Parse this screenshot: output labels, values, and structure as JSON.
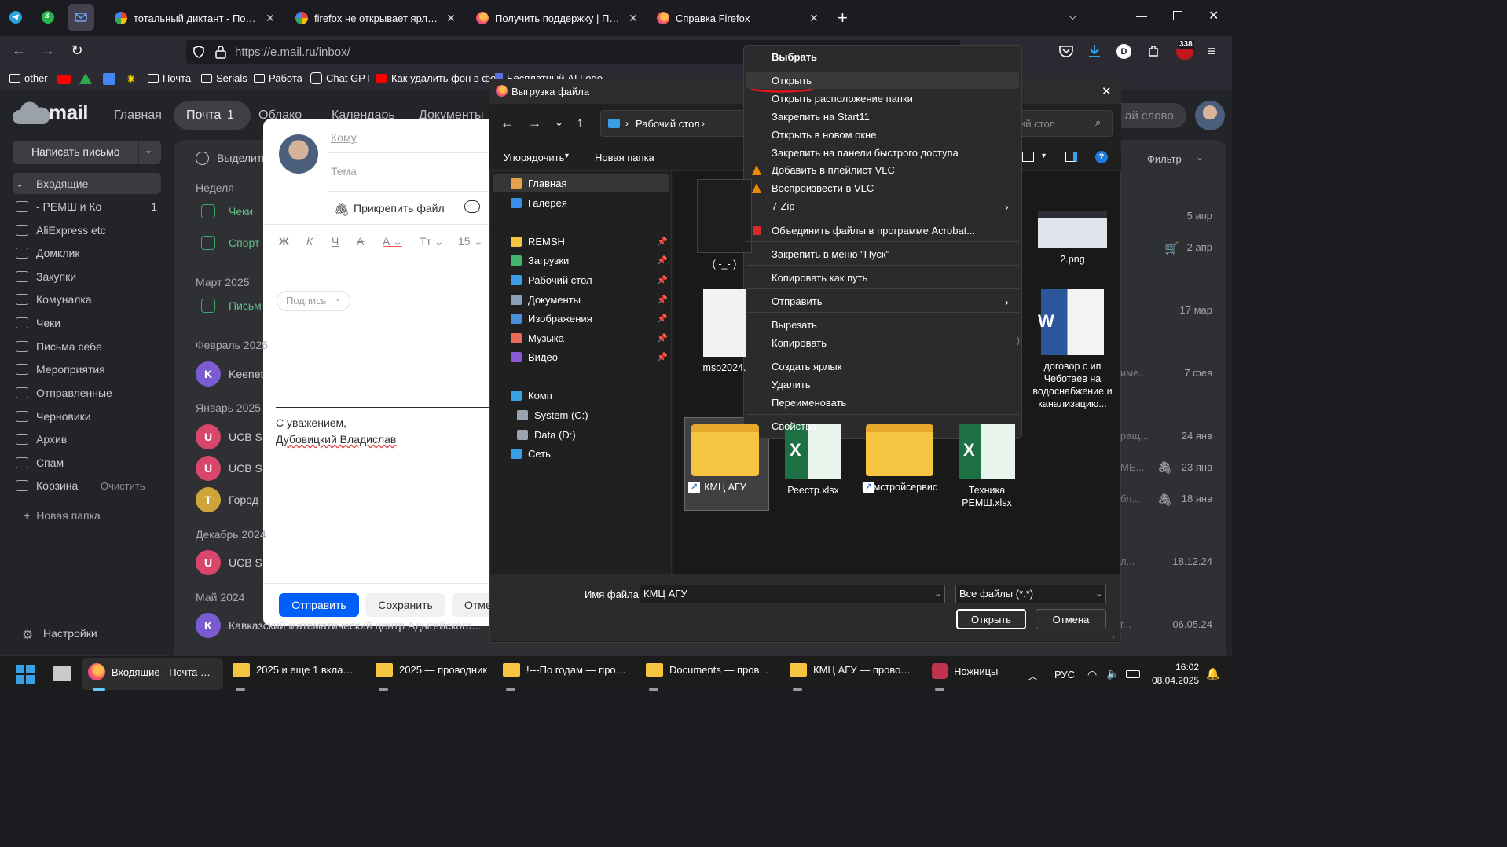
{
  "browser": {
    "tabs": [
      {
        "label": "тотальный диктант - Поиск в G",
        "favicon": "google-icon"
      },
      {
        "label": "firefox не открывает ярлык па",
        "favicon": "google-icon"
      },
      {
        "label": "Получить поддержку | Поддерж",
        "favicon": "firefox-icon"
      },
      {
        "label": "Справка Firefox",
        "favicon": "firefox-icon"
      }
    ],
    "pinned_badge": "3",
    "url": "https://e.mail.ru/inbox/",
    "bookmarks": [
      "other",
      "Почта",
      "Serials",
      "Работа",
      "Chat GPT",
      "Как удалить фон в фо...",
      "Бесплатный AI Logo"
    ],
    "notif_count": "338",
    "profile_letter": "D"
  },
  "mail": {
    "logo": "mail",
    "nav": {
      "home": "Главная",
      "mail": "Почта",
      "mail_count": "1",
      "cloud": "Облако",
      "calendar": "Календарь",
      "docs": "Документы"
    },
    "search_placeholder": "ай слово",
    "compose_button": "Написать письмо",
    "folders": [
      {
        "label": "Входящие",
        "count": ""
      },
      {
        "label": "- РЕМШ и Ко",
        "count": "1"
      },
      {
        "label": "AliExpress etc",
        "count": ""
      },
      {
        "label": "Домклик",
        "count": ""
      },
      {
        "label": "Закупки",
        "count": ""
      },
      {
        "label": "Комуналка",
        "count": ""
      },
      {
        "label": "Чеки",
        "count": ""
      },
      {
        "label": "Письма себе",
        "count": ""
      },
      {
        "label": "Мероприятия",
        "count": ""
      },
      {
        "label": "Отправленные",
        "count": ""
      },
      {
        "label": "Черновики",
        "count": ""
      },
      {
        "label": "Архив",
        "count": ""
      },
      {
        "label": "Спам",
        "count": ""
      },
      {
        "label": "Корзина",
        "count": ""
      }
    ],
    "clear_label": "Очистить",
    "new_folder": "Новая папка",
    "settings": "Настройки",
    "select_label": "Выделить",
    "filter_label": "Фильтр",
    "groups": [
      "Неделя",
      "Март 2025",
      "Февраль 2025",
      "Январь 2025",
      "Декабрь 2024",
      "Май 2024"
    ],
    "rows": [
      {
        "sender": "Чеки",
        "date": "5 апр",
        "avatar": ""
      },
      {
        "sender": "Спорт",
        "date": "2 апр",
        "avatar": ""
      },
      {
        "sender": "Письм",
        "date": "17 мар",
        "avatar": ""
      },
      {
        "sender": "Keenet",
        "date": "7 фев",
        "avatar": "K",
        "snippet": "име..."
      },
      {
        "sender": "UCB S",
        "date": "24 янв",
        "avatar": "U",
        "snippet": "ращ..."
      },
      {
        "sender": "UCB S",
        "date": "23 янв",
        "avatar": "U",
        "snippet": "МЕ..."
      },
      {
        "sender": "Город",
        "date": "18 янв",
        "avatar": "T",
        "snippet": "бл..."
      },
      {
        "sender": "UCB S",
        "date": "18.12.24",
        "avatar": "U",
        "snippet": "л..."
      },
      {
        "sender": "Кавказский математический центр Адыгейского...",
        "date": "06.05.24",
        "avatar": "K",
        "snippet": "г..."
      }
    ]
  },
  "compose": {
    "to_placeholder": "Кому",
    "subject_placeholder": "Тема",
    "attach": "Прикрепить файл",
    "font_size": "15",
    "signature_chip": "Подпись",
    "signature_line1": "С уважением,",
    "signature_line2": "Дубовицкий Владислав",
    "send": "Отправить",
    "save": "Сохранить",
    "cancel": "Отме"
  },
  "dialog": {
    "title": "Выгрузка файла",
    "path": "Рабочий стол",
    "search_placeholder": "ий стол",
    "organize": "Упорядочить",
    "new_folder": "Новая папка",
    "nav_items": [
      {
        "label": "Главная",
        "pinned": false,
        "color": "#e8a24a"
      },
      {
        "label": "Галерея",
        "pinned": false,
        "color": "#3a8ee6"
      },
      {
        "label": "REMSH",
        "pinned": true,
        "color": "#f5c542"
      },
      {
        "label": "Загрузки",
        "pinned": true,
        "color": "#41b56f"
      },
      {
        "label": "Рабочий стол",
        "pinned": true,
        "color": "#3aa0e6"
      },
      {
        "label": "Документы",
        "pinned": true,
        "color": "#8a9fb8"
      },
      {
        "label": "Изображения",
        "pinned": true,
        "color": "#4a90d9"
      },
      {
        "label": "Музыка",
        "pinned": true,
        "color": "#e96b5a"
      },
      {
        "label": "Видео",
        "pinned": true,
        "color": "#8b5bd6"
      },
      {
        "label": "Комп",
        "pinned": false,
        "color": "#3aa0e6"
      },
      {
        "label": "System (C:)",
        "pinned": false,
        "color": "#9aa4b0"
      },
      {
        "label": "Data (D:)",
        "pinned": false,
        "color": "#9aa4b0"
      },
      {
        "label": "Сеть",
        "pinned": false,
        "color": "#3aa0e6"
      }
    ],
    "files": [
      {
        "name": "( -_- )",
        "type": "shortcut-app"
      },
      {
        "name": "2.png",
        "type": "image"
      },
      {
        "name": "mso2024.",
        "type": "document"
      },
      {
        "name": "договор с ип Чеботаев на водоснабжение и канализацию...",
        "type": "word"
      },
      {
        "name": "КМЦ АГУ",
        "type": "folder-shortcut"
      },
      {
        "name": "Реестр.xlsx",
        "type": "excel"
      },
      {
        "name": "Ремстройсервис",
        "type": "folder-shortcut"
      },
      {
        "name": "Техника РЕМШ.xlsx",
        "type": "excel"
      }
    ],
    "filter_button": "Фильтр",
    "filename_label": "Имя файла:",
    "filename_value": "КМЦ АГУ",
    "filetype_value": "Все файлы (*.*)",
    "open_button": "Открыть",
    "cancel_button": "Отмена"
  },
  "context_menu": {
    "header": "Выбрать",
    "items": [
      {
        "label": "Открыть",
        "icon": "",
        "submenu": false
      },
      {
        "label": "Открыть расположение папки",
        "icon": "",
        "submenu": false
      },
      {
        "label": "Закрепить на Start11",
        "icon": "",
        "submenu": false
      },
      {
        "label": "Открыть в новом окне",
        "icon": "",
        "submenu": false
      },
      {
        "label": "Закрепить на панели быстрого доступа",
        "icon": "",
        "submenu": false
      },
      {
        "label": "Добавить в плейлист VLC",
        "icon": "vlc-icon",
        "submenu": false
      },
      {
        "label": "Воспроизвести в VLC",
        "icon": "vlc-icon",
        "submenu": false
      },
      {
        "label": "7-Zip",
        "icon": "",
        "submenu": true
      },
      {
        "label": "Объединить файлы в программе Acrobat...",
        "icon": "acrobat-icon",
        "submenu": false
      },
      {
        "label": "Закрепить в меню \"Пуск\"",
        "icon": "",
        "submenu": false
      },
      {
        "label": "Копировать как путь",
        "icon": "",
        "submenu": false
      },
      {
        "label": "Отправить",
        "icon": "",
        "submenu": true
      },
      {
        "label": "Вырезать",
        "icon": "",
        "submenu": false
      },
      {
        "label": "Копировать",
        "icon": "",
        "submenu": false
      },
      {
        "label": "Создать ярлык",
        "icon": "",
        "submenu": false
      },
      {
        "label": "Удалить",
        "icon": "",
        "submenu": false
      },
      {
        "label": "Переименовать",
        "icon": "",
        "submenu": false
      },
      {
        "label": "Свойства",
        "icon": "",
        "submenu": false
      }
    ],
    "highlight_color": "#e0161d"
  },
  "taskbar": {
    "items": [
      "Входящие - Почта Mai",
      "2025 и еще 1 вкладка -",
      "2025 — проводник",
      "!---По годам — провод",
      "Documents — проводн",
      "КМЦ АГУ — проводни",
      "Ножницы"
    ],
    "lang": "РУС",
    "time": "16:02",
    "date": "08.04.2025"
  }
}
